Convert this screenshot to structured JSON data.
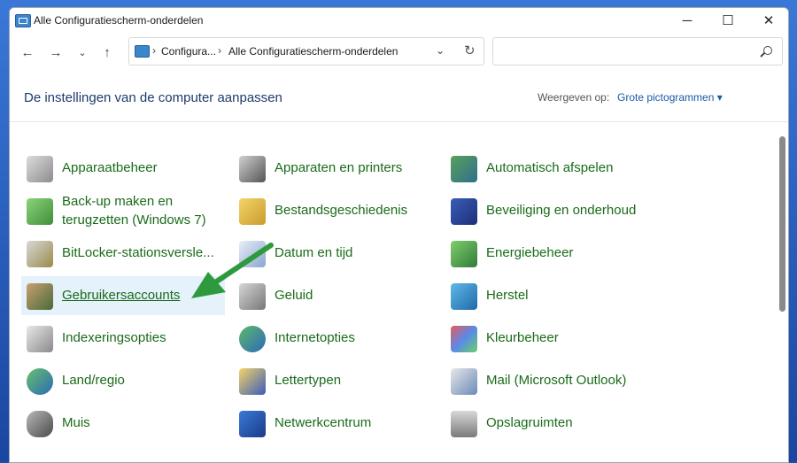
{
  "window": {
    "title": "Alle Configuratiescherm-onderdelen",
    "minimize": "─",
    "maximize": "☐",
    "close": "✕"
  },
  "nav": {
    "back": "←",
    "forward": "→",
    "recent": "⌄",
    "up": "↑"
  },
  "address": {
    "crumbs": [
      "Configura...",
      "Alle Configuratiescherm-onderdelen"
    ],
    "separator": "›",
    "dropdown": "⌄",
    "refresh": "↻"
  },
  "search": {
    "placeholder": ""
  },
  "header": {
    "heading": "De instellingen van de computer aanpassen",
    "view_label": "Weergeven op:",
    "view_value": "Grote pictogrammen ▾"
  },
  "items": [
    [
      "Apparaatbeheer",
      "Apparaten en printers",
      "Automatisch afspelen"
    ],
    [
      "Back-up maken en terugzetten (Windows 7)",
      "Bestandsgeschiedenis",
      "Beveiliging en onderhoud"
    ],
    [
      "BitLocker-stationsversle...",
      "Datum en tijd",
      "Energiebeheer"
    ],
    [
      "Gebruikersaccounts",
      "Geluid",
      "Herstel"
    ],
    [
      "Indexeringsopties",
      "Internetopties",
      "Kleurbeheer"
    ],
    [
      "Land/regio",
      "Lettertypen",
      "Mail (Microsoft Outlook)"
    ],
    [
      "Muis",
      "Netwerkcentrum",
      "Opslagruimten"
    ]
  ],
  "colors": {
    "label": "#1a6b1a",
    "selected_bg": "#e5f1fb",
    "arrow": "#2e9a3e",
    "heading": "#1e3a6e"
  }
}
